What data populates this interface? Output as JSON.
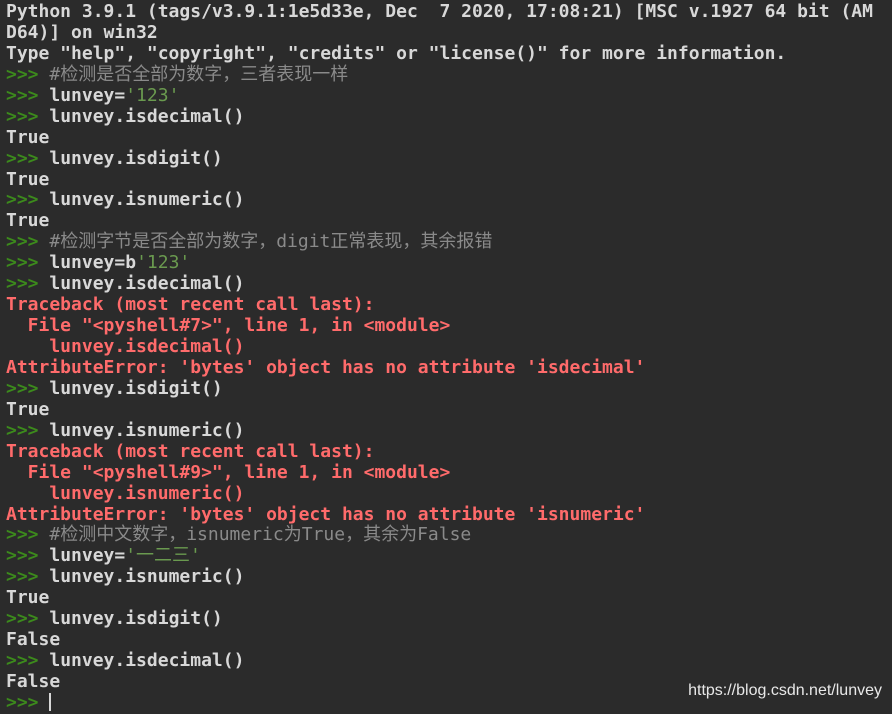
{
  "colors": {
    "background": "#2b2b2b",
    "text": "#d8d8d8",
    "prompt": "#3c8a1c",
    "comment": "#8a8a8a",
    "string": "#6a9a4f",
    "error": "#ff6b6b"
  },
  "lines": [
    [
      {
        "k": "output",
        "t": "Python 3.9.1 (tags/v3.9.1:1e5d33e, Dec  7 2020, 17:08:21) [MSC v.1927 64 bit (AM"
      }
    ],
    [
      {
        "k": "output",
        "t": "D64)] on win32"
      }
    ],
    [
      {
        "k": "output",
        "t": "Type \"help\", \"copyright\", \"credits\" or \"license()\" for more information."
      }
    ],
    [
      {
        "k": "prompt",
        "t": ">>> "
      },
      {
        "k": "comment",
        "t": "#检测是否全部为数字，三者表现一样"
      }
    ],
    [
      {
        "k": "prompt",
        "t": ">>> "
      },
      {
        "k": "code",
        "t": "lunvey="
      },
      {
        "k": "string",
        "t": "'123'"
      }
    ],
    [
      {
        "k": "prompt",
        "t": ">>> "
      },
      {
        "k": "code",
        "t": "lunvey.isdecimal()"
      }
    ],
    [
      {
        "k": "output",
        "t": "True"
      }
    ],
    [
      {
        "k": "prompt",
        "t": ">>> "
      },
      {
        "k": "code",
        "t": "lunvey.isdigit()"
      }
    ],
    [
      {
        "k": "output",
        "t": "True"
      }
    ],
    [
      {
        "k": "prompt",
        "t": ">>> "
      },
      {
        "k": "code",
        "t": "lunvey.isnumeric()"
      }
    ],
    [
      {
        "k": "output",
        "t": "True"
      }
    ],
    [
      {
        "k": "prompt",
        "t": ">>> "
      },
      {
        "k": "comment",
        "t": "#检测字节是否全部为数字，digit正常表现，其余报错"
      }
    ],
    [
      {
        "k": "prompt",
        "t": ">>> "
      },
      {
        "k": "code",
        "t": "lunvey=b"
      },
      {
        "k": "string",
        "t": "'123'"
      }
    ],
    [
      {
        "k": "prompt",
        "t": ">>> "
      },
      {
        "k": "code",
        "t": "lunvey.isdecimal()"
      }
    ],
    [
      {
        "k": "error",
        "t": "Traceback (most recent call last):"
      }
    ],
    [
      {
        "k": "error",
        "t": "  File \"<pyshell#7>\", line 1, in <module>"
      }
    ],
    [
      {
        "k": "error",
        "t": "    lunvey.isdecimal()"
      }
    ],
    [
      {
        "k": "error",
        "t": "AttributeError: 'bytes' object has no attribute 'isdecimal'"
      }
    ],
    [
      {
        "k": "prompt",
        "t": ">>> "
      },
      {
        "k": "code",
        "t": "lunvey.isdigit()"
      }
    ],
    [
      {
        "k": "output",
        "t": "True"
      }
    ],
    [
      {
        "k": "prompt",
        "t": ">>> "
      },
      {
        "k": "code",
        "t": "lunvey.isnumeric()"
      }
    ],
    [
      {
        "k": "error",
        "t": "Traceback (most recent call last):"
      }
    ],
    [
      {
        "k": "error",
        "t": "  File \"<pyshell#9>\", line 1, in <module>"
      }
    ],
    [
      {
        "k": "error",
        "t": "    lunvey.isnumeric()"
      }
    ],
    [
      {
        "k": "error",
        "t": "AttributeError: 'bytes' object has no attribute 'isnumeric'"
      }
    ],
    [
      {
        "k": "prompt",
        "t": ">>> "
      },
      {
        "k": "comment",
        "t": "#检测中文数字，isnumeric为True，其余为False"
      }
    ],
    [
      {
        "k": "prompt",
        "t": ">>> "
      },
      {
        "k": "code",
        "t": "lunvey="
      },
      {
        "k": "string",
        "t": "'一二三'"
      }
    ],
    [
      {
        "k": "prompt",
        "t": ">>> "
      },
      {
        "k": "code",
        "t": "lunvey.isnumeric()"
      }
    ],
    [
      {
        "k": "output",
        "t": "True"
      }
    ],
    [
      {
        "k": "prompt",
        "t": ">>> "
      },
      {
        "k": "code",
        "t": "lunvey.isdigit()"
      }
    ],
    [
      {
        "k": "output",
        "t": "False"
      }
    ],
    [
      {
        "k": "prompt",
        "t": ">>> "
      },
      {
        "k": "code",
        "t": "lunvey.isdecimal()"
      }
    ],
    [
      {
        "k": "output",
        "t": "False"
      }
    ],
    [
      {
        "k": "prompt",
        "t": ">>> "
      },
      {
        "k": "cursor",
        "t": ""
      }
    ]
  ],
  "watermark": "https://blog.csdn.net/lunvey"
}
